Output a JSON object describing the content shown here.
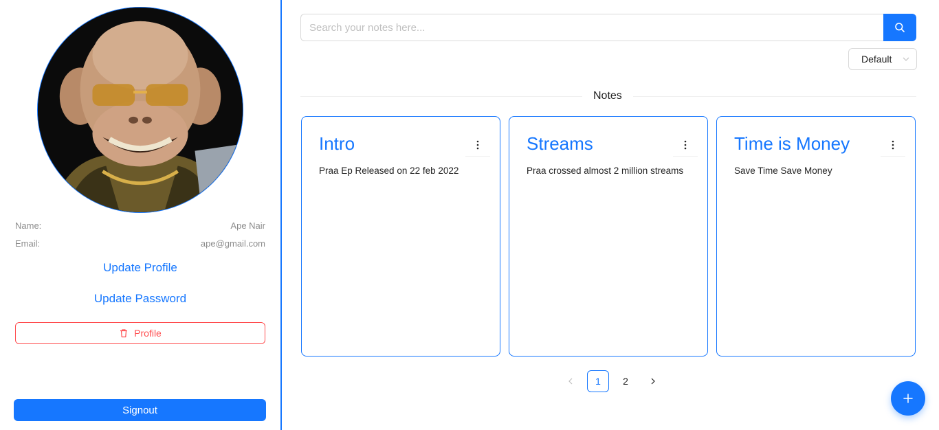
{
  "profile": {
    "name_label": "Name:",
    "name_value": "Ape Nair",
    "email_label": "Email:",
    "email_value": "ape@gmail.com",
    "update_profile_label": "Update Profile",
    "update_password_label": "Update Password",
    "delete_label": "Profile",
    "signout_label": "Signout"
  },
  "search": {
    "placeholder": "Search your notes here..."
  },
  "sort": {
    "selected": "Default"
  },
  "notes_section": {
    "title": "Notes",
    "cards": [
      {
        "title": "Intro",
        "body": "Praa Ep Released on 22 feb 2022"
      },
      {
        "title": "Streams",
        "body": "Praa crossed almost 2 million streams"
      },
      {
        "title": "Time is Money",
        "body": "Save Time Save Money"
      }
    ]
  },
  "pagination": {
    "pages": [
      "1",
      "2"
    ],
    "current": "1"
  },
  "colors": {
    "accent": "#1677ff",
    "danger": "#ff4d4f",
    "muted_text": "#8c8c8c"
  },
  "icons": {
    "search": "search-icon",
    "delete": "trash-icon",
    "sort": "chevron-down-icon",
    "menu": "more-vertical-icon",
    "add": "plus-icon"
  }
}
